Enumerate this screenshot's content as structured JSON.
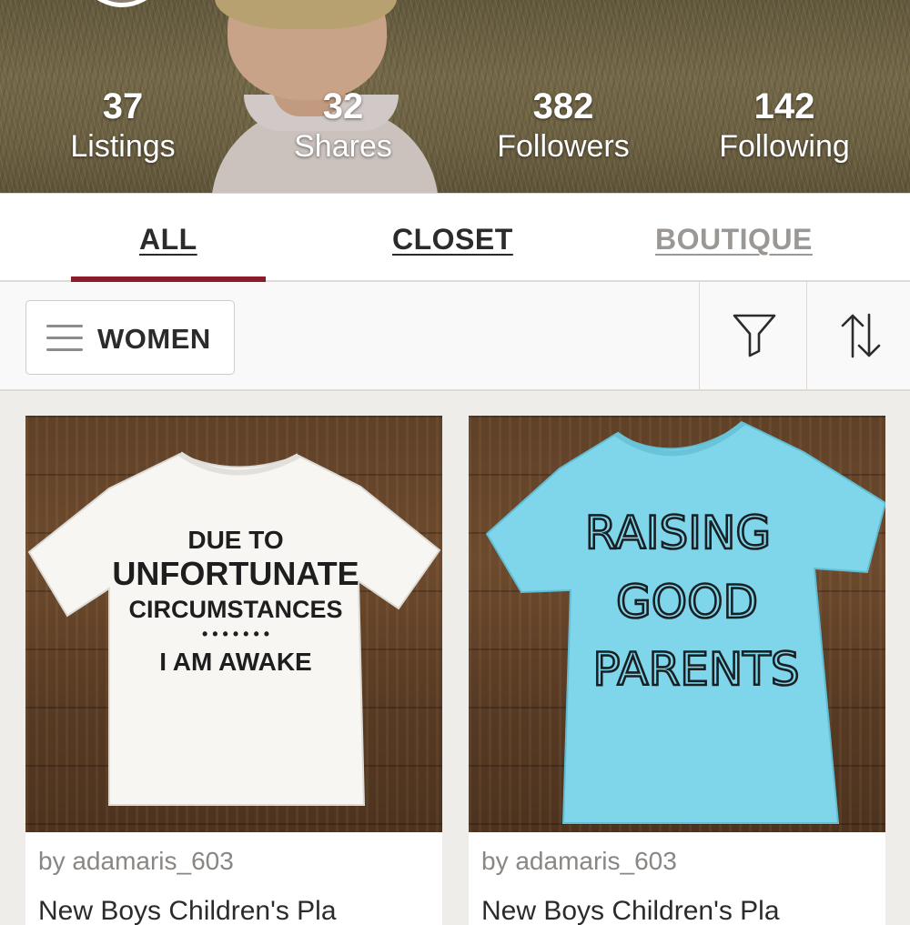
{
  "profile": {
    "stats": [
      {
        "value": "37",
        "label": "Listings"
      },
      {
        "value": "32",
        "label": "Shares"
      },
      {
        "value": "382",
        "label": "Followers"
      },
      {
        "value": "142",
        "label": "Following"
      }
    ]
  },
  "tabs": {
    "items": [
      {
        "label": "ALL",
        "active": true
      },
      {
        "label": "CLOSET",
        "active": false
      },
      {
        "label": "BOUTIQUE",
        "active": false
      }
    ],
    "active_color": "#8b1a2b"
  },
  "filters": {
    "department": "WOMEN",
    "filter_icon": "filter-funnel-icon",
    "sort_icon": "sort-arrows-icon"
  },
  "listings": [
    {
      "seller": "by adamaris_603",
      "title": "New Boys Children's Pla",
      "shirt_color": "#f7f6f3",
      "shirt_text": [
        "DUE TO",
        "UNFORTUNATE",
        "CIRCUMSTANCES",
        "• • • • • • •",
        "I AM AWAKE"
      ]
    },
    {
      "seller": "by adamaris_603",
      "title": "New Boys Children's Pla",
      "shirt_color": "#7fd6ea",
      "shirt_text": [
        "RAISING",
        "GOOD",
        "PARENTS"
      ]
    }
  ]
}
